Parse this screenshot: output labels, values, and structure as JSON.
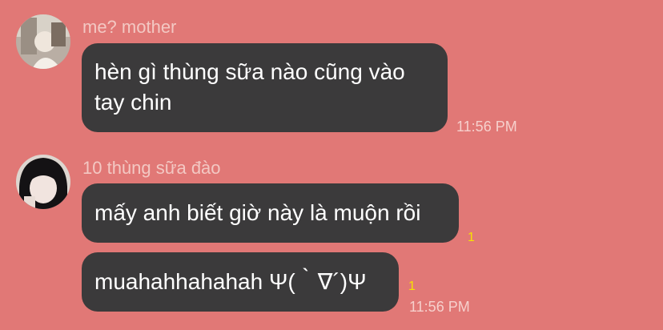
{
  "messages": [
    {
      "sender": "me? mother",
      "text_lines": [
        "hèn gì thùng sữa nào cũng vào",
        "tay chin"
      ],
      "time": "11:56 PM"
    },
    {
      "sender": "10 thùng sữa đào",
      "bubbles": [
        {
          "text": "mấy anh biết giờ này là muộn rồi",
          "read_count": "1"
        },
        {
          "text": "muahahhahahah Ψ(｀∇´)Ψ",
          "read_count": "1",
          "time": "11:56 PM"
        }
      ]
    }
  ],
  "colors": {
    "background": "#e17876",
    "bubble": "#3b3a3b",
    "read_indicator": "#f5e200"
  }
}
